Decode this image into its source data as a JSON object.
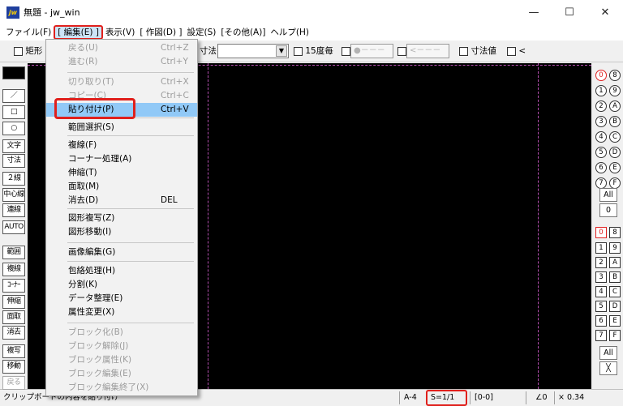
{
  "window": {
    "title": "無題 - jw_win",
    "app_icon_text": "jw",
    "controls": {
      "minimize": "—",
      "maximize": "☐",
      "close": "✕"
    }
  },
  "menubar": {
    "items": [
      {
        "label": "ファイル(F)"
      },
      {
        "label": "[ 編集(E) ]",
        "open": true
      },
      {
        "label": "表示(V)"
      },
      {
        "label": "[ 作図(D) ]"
      },
      {
        "label": "設定(S)"
      },
      {
        "label": "[その他(A)]"
      },
      {
        "label": "ヘルプ(H)"
      }
    ]
  },
  "toolbar": {
    "rect_label": "矩形",
    "dim_label": "寸法",
    "angle_label": "15度毎",
    "field1": "●－－－",
    "field2": "<－－－",
    "dim_value_label": "寸法値",
    "lt_label": "<"
  },
  "left_panel": {
    "tools": [
      {
        "label": "／"
      },
      {
        "label": "□"
      },
      {
        "label": "○"
      },
      {
        "label": "文字"
      },
      {
        "label": "寸法"
      },
      {
        "label": "２線"
      },
      {
        "label": "中心線"
      },
      {
        "label": "連線"
      },
      {
        "label": "AUTO"
      },
      {
        "label": "範囲"
      },
      {
        "label": "複線"
      },
      {
        "label": "ｺｰﾅｰ"
      },
      {
        "label": "伸縮"
      },
      {
        "label": "面取"
      },
      {
        "label": "消去"
      },
      {
        "label": "複写"
      },
      {
        "label": "移動"
      },
      {
        "label": "戻る",
        "disabled": true
      }
    ]
  },
  "right_panel": {
    "layer_groups_top": [
      [
        "0",
        "8"
      ],
      [
        "1",
        "9"
      ],
      [
        "2",
        "A"
      ],
      [
        "3",
        "B"
      ],
      [
        "4",
        "C"
      ],
      [
        "5",
        "D"
      ],
      [
        "6",
        "E"
      ],
      [
        "7",
        "F"
      ]
    ],
    "all_label": "All",
    "zero_label": "0",
    "layers_bottom": [
      [
        "0",
        "8"
      ],
      [
        "1",
        "9"
      ],
      [
        "2",
        "A"
      ],
      [
        "3",
        "B"
      ],
      [
        "4",
        "C"
      ],
      [
        "5",
        "D"
      ],
      [
        "6",
        "E"
      ],
      [
        "7",
        "F"
      ]
    ],
    "all2_label": "All",
    "arrow_label": "╳"
  },
  "edit_menu": {
    "groups": [
      [
        {
          "label": "戻る(U)",
          "shortcut": "Ctrl+Z",
          "disabled": true
        },
        {
          "label": "進む(R)",
          "shortcut": "Ctrl+Y",
          "disabled": true
        }
      ],
      [
        {
          "label": "切り取り(T)",
          "shortcut": "Ctrl+X",
          "disabled": true
        },
        {
          "label": "コピー(C)",
          "shortcut": "Ctrl+C",
          "disabled": true
        },
        {
          "label": "貼り付け(P)",
          "shortcut": "Ctrl+V",
          "highlighted": true
        }
      ],
      [
        {
          "label": "範囲選択(S)",
          "shortcut": ""
        }
      ],
      [
        {
          "label": "複線(F)",
          "shortcut": ""
        },
        {
          "label": "コーナー処理(A)",
          "shortcut": ""
        },
        {
          "label": "伸縮(T)",
          "shortcut": ""
        },
        {
          "label": "面取(M)",
          "shortcut": ""
        },
        {
          "label": "消去(D)",
          "shortcut": "DEL"
        }
      ],
      [
        {
          "label": "図形複写(Z)",
          "shortcut": ""
        },
        {
          "label": "図形移動(I)",
          "shortcut": ""
        }
      ],
      [
        {
          "label": "画像編集(G)",
          "shortcut": ""
        }
      ],
      [
        {
          "label": "包絡処理(H)",
          "shortcut": ""
        },
        {
          "label": "分割(K)",
          "shortcut": ""
        },
        {
          "label": "データ整理(E)",
          "shortcut": ""
        },
        {
          "label": "属性変更(X)",
          "shortcut": ""
        }
      ],
      [
        {
          "label": "ブロック化(B)",
          "shortcut": "",
          "disabled": true
        },
        {
          "label": "ブロック解除(J)",
          "shortcut": "",
          "disabled": true
        },
        {
          "label": "ブロック属性(K)",
          "shortcut": "",
          "disabled": true
        },
        {
          "label": "ブロック編集(E)",
          "shortcut": "",
          "disabled": true
        },
        {
          "label": "ブロック編集終了(X)",
          "shortcut": "",
          "disabled": true
        }
      ]
    ]
  },
  "statusbar": {
    "message": "クリップボードの内容を貼り付け",
    "paper": "A-4",
    "scale": "S=1/1",
    "layer": "[0-0]",
    "angle": "∠0",
    "factor": "× 0.34"
  },
  "colors": {
    "highlight": "#91c9f7",
    "annotation_red": "#e0201c",
    "canvas": "#000000"
  }
}
